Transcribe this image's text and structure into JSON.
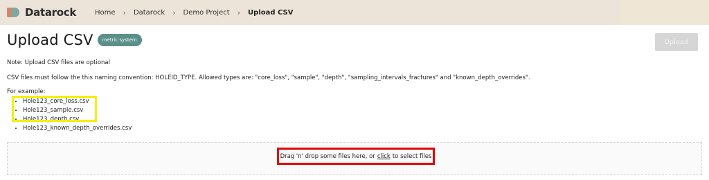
{
  "app": {
    "name": "Datarock"
  },
  "breadcrumb": {
    "items": [
      "Home",
      "Datarock",
      "Demo Project",
      "Upload CSV"
    ],
    "separator": "›"
  },
  "page": {
    "title": "Upload CSV",
    "badge": "metric system",
    "upload_label": "Upload"
  },
  "content": {
    "note": "Note: Upload CSV files are optional",
    "convention": "CSV files must follow the this naming convention: HOLEID_TYPE. Allowed types are: \"core_loss\", \"sample\", \"depth\", \"sampling_intervals_fractures\" and \"known_depth_overrides\".",
    "example_label": "For example:",
    "files": [
      "Hole123_core_loss.csv",
      "Hole123_sample.csv",
      "Hole123_depth.csv",
      "Hole123_known_depth_overrides.csv"
    ]
  },
  "dropzone": {
    "text_before": "Drag 'n' drop some files here, or",
    "link": "click",
    "text_after": "to select files"
  },
  "colors": {
    "topbar": "#ece4d8",
    "badge": "#5b8f8a",
    "highlight_yellow": "#f5f000",
    "highlight_red": "#e00000"
  }
}
